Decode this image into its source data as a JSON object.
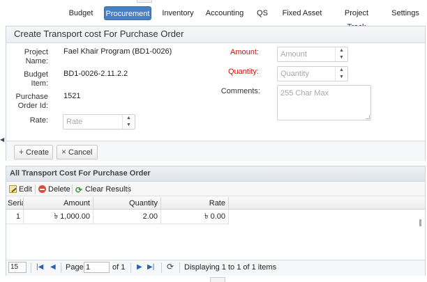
{
  "nav": {
    "items": [
      {
        "label": "Budget"
      },
      {
        "label": "Procurement",
        "active": true
      },
      {
        "label": "Inventory"
      },
      {
        "label": "Accounting"
      },
      {
        "label": "QS"
      },
      {
        "label": "Fixed Asset"
      },
      {
        "label": "Project Track"
      },
      {
        "label": "Settings"
      }
    ]
  },
  "form": {
    "title": "Create Transport cost For Purchase Order",
    "project_name_label": "Project Name:",
    "project_name_value": "Fael Khair Program (BD1-0026)",
    "budget_item_label": "Budget Item:",
    "budget_item_value": "BD1-0026-2.11.2.2",
    "purchase_order_label": "Purchase Order Id:",
    "purchase_order_value": "1521",
    "rate_label": "Rate:",
    "rate_placeholder": "Rate",
    "amount_label": "Amount:",
    "amount_placeholder": "Amount",
    "quantity_label": "Quantity:",
    "quantity_placeholder": "Quantity",
    "comments_label": "Comments:",
    "comments_placeholder": "255 Char Max",
    "create_label": "Create",
    "cancel_label": "Cancel"
  },
  "grid": {
    "title": "All Transport Cost For Purchase Order",
    "toolbar": {
      "edit": "Edit",
      "delete": "Delete",
      "clear": "Clear Results"
    },
    "columns": [
      "Serial",
      "Amount",
      "Quantity",
      "Rate"
    ],
    "rows": [
      {
        "serial": "1",
        "amount": "৳ 1,000.00",
        "quantity": "2.00",
        "rate": "৳ 0.00"
      }
    ],
    "pager": {
      "page_size": "15",
      "page_label": "Page",
      "page_value": "1",
      "of_label": "of 1",
      "display_text": "Displaying 1 to 1 of 1 items"
    }
  },
  "colors": {
    "accent": "#4a7fc1",
    "required": "#d01010"
  }
}
